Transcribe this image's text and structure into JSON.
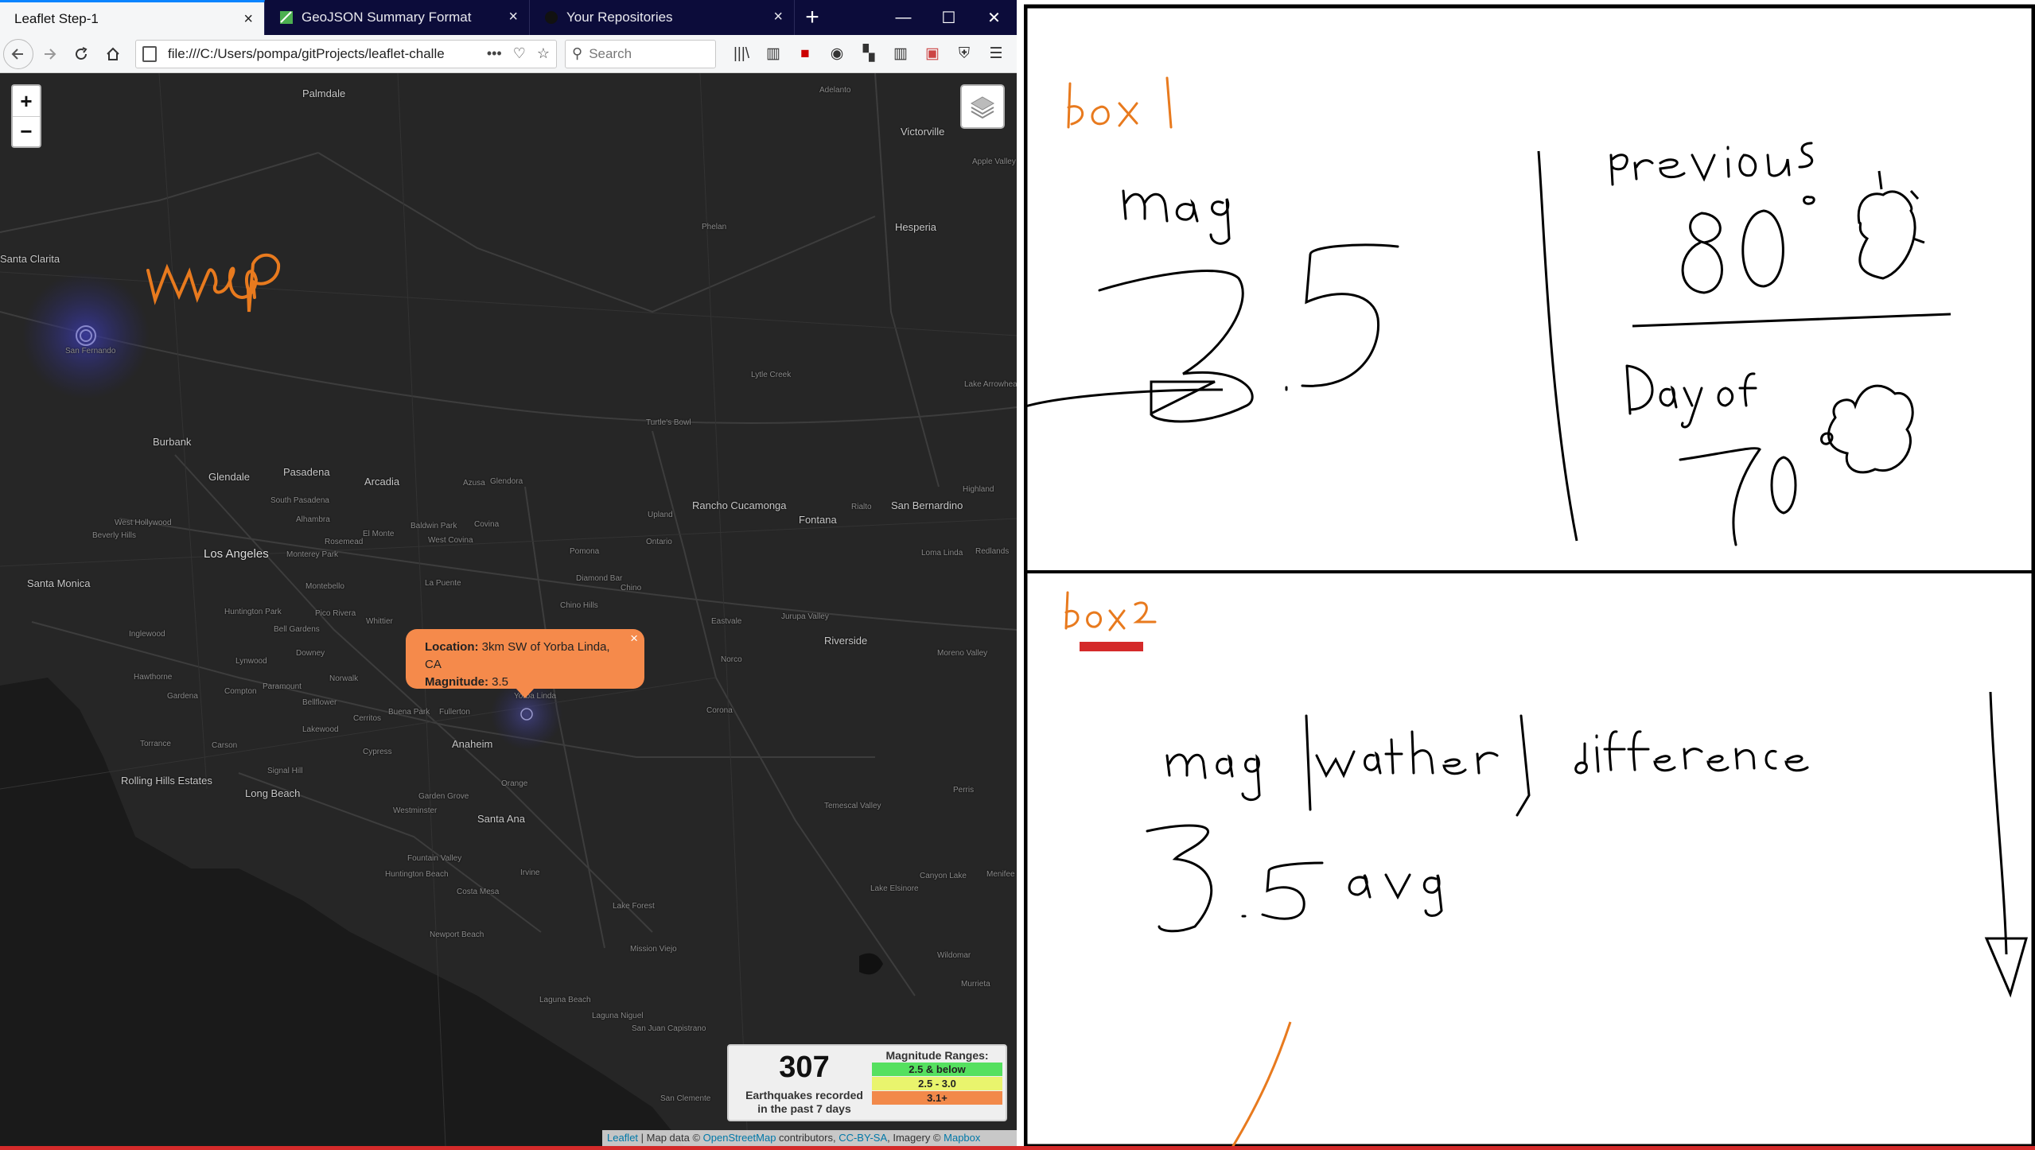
{
  "browser": {
    "tabs": [
      {
        "title": "Leaflet Step-1",
        "active": true
      },
      {
        "title": "GeoJSON Summary Format",
        "active": false
      },
      {
        "title": "Your Repositories",
        "active": false
      }
    ],
    "url": "file:///C:/Users/pompa/gitProjects/leaflet-challe",
    "search_placeholder": "Search"
  },
  "map": {
    "zoom_in": "+",
    "zoom_out": "−",
    "places": [
      "Palmdale",
      "Adelanto",
      "Victorville",
      "Apple Valley",
      "Hesperia",
      "Santa Clarita",
      "San Fernando",
      "Burbank",
      "Glendale",
      "Pasadena",
      "Arcadia",
      "Azusa",
      "Glendora",
      "Upland",
      "Rancho Cucamonga",
      "Fontana",
      "San Bernardino",
      "Highland",
      "Redlands",
      "Rialto",
      "Ontario",
      "Pomona",
      "West Covina",
      "Covina",
      "Baldwin Park",
      "Los Angeles",
      "West Hollywood",
      "Beverly Hills",
      "Santa Monica",
      "Monterey Park",
      "Alhambra",
      "South Pasadena",
      "Rosemead",
      "El Monte",
      "Inglewood",
      "Hawthorne",
      "Gardena",
      "Compton",
      "Downey",
      "Whittier",
      "Norwalk",
      "Bellflower",
      "Lakewood",
      "Cerritos",
      "Buena Park",
      "Fullerton",
      "Yorba Linda",
      "Chino",
      "Chino Hills",
      "Eastvale",
      "Jurupa Valley",
      "Riverside",
      "Moreno Valley",
      "Norco",
      "Corona",
      "Anaheim",
      "Orange",
      "Santa Ana",
      "Garden Grove",
      "Westminster",
      "Torrance",
      "Carson",
      "Long Beach",
      "Rolling Hills Estates",
      "Huntington Beach",
      "Fountain Valley",
      "Costa Mesa",
      "Irvine",
      "Newport Beach",
      "Lake Forest",
      "Mission Viejo",
      "Laguna Beach",
      "Laguna Niguel",
      "San Juan Capistrano",
      "San Clemente",
      "Lake Elsinore",
      "Wildomar",
      "Murrieta",
      "Perris",
      "Menifee",
      "Lytle Creek",
      "Phelan",
      "Diamond Bar",
      "La Puente",
      "Montebello",
      "Pico Rivera",
      "Huntington Park",
      "Bell Gardens",
      "Lynwood",
      "Paramount",
      "Cypress",
      "Signal Hill",
      "Loma Linda",
      "Temescal Valley",
      "Canyon Lake",
      "Lake Arrowhead",
      "Turtle's Bowl"
    ],
    "popup": {
      "location_label": "Location:",
      "location_value": "3km SW of Yorba Linda, CA",
      "magnitude_label": "Magnitude:",
      "magnitude_value": "3.5",
      "close": "×"
    },
    "info": {
      "count": "307",
      "caption_line1": "Earthquakes recorded",
      "caption_line2": "in the past 7 days",
      "legend_title": "Magnitude Ranges:",
      "ranges": [
        {
          "label": "2.5 & below",
          "color": "#55e05f"
        },
        {
          "label": "2.5 - 3.0",
          "color": "#e9f46d"
        },
        {
          "label": "3.1+",
          "color": "#f2894a"
        }
      ]
    },
    "attribution": {
      "leaflet": "Leaflet",
      "text1": " | Map data © ",
      "osm": "OpenStreetMap",
      "text2": " contributors, ",
      "license": "CC-BY-SA",
      "text3": ", Imagery © ",
      "mapbox": "Mapbox"
    },
    "sketch_label": "map"
  },
  "board": {
    "box1": {
      "label": "box 1",
      "mag_label": "mag",
      "mag_value": "3.5",
      "previous_label": "previous",
      "previous_temp": "80°",
      "dayof_label": "Day of",
      "dayof_temp": "70°"
    },
    "box2": {
      "label": "box 2",
      "header": "mag / wather / difference",
      "value": "3.5",
      "avg": "avg"
    }
  },
  "colors": {
    "map_bg": "#262626",
    "popup": "#f58a4b",
    "annotation_orange": "#e87a1e",
    "accent_red": "#d42a2a"
  }
}
